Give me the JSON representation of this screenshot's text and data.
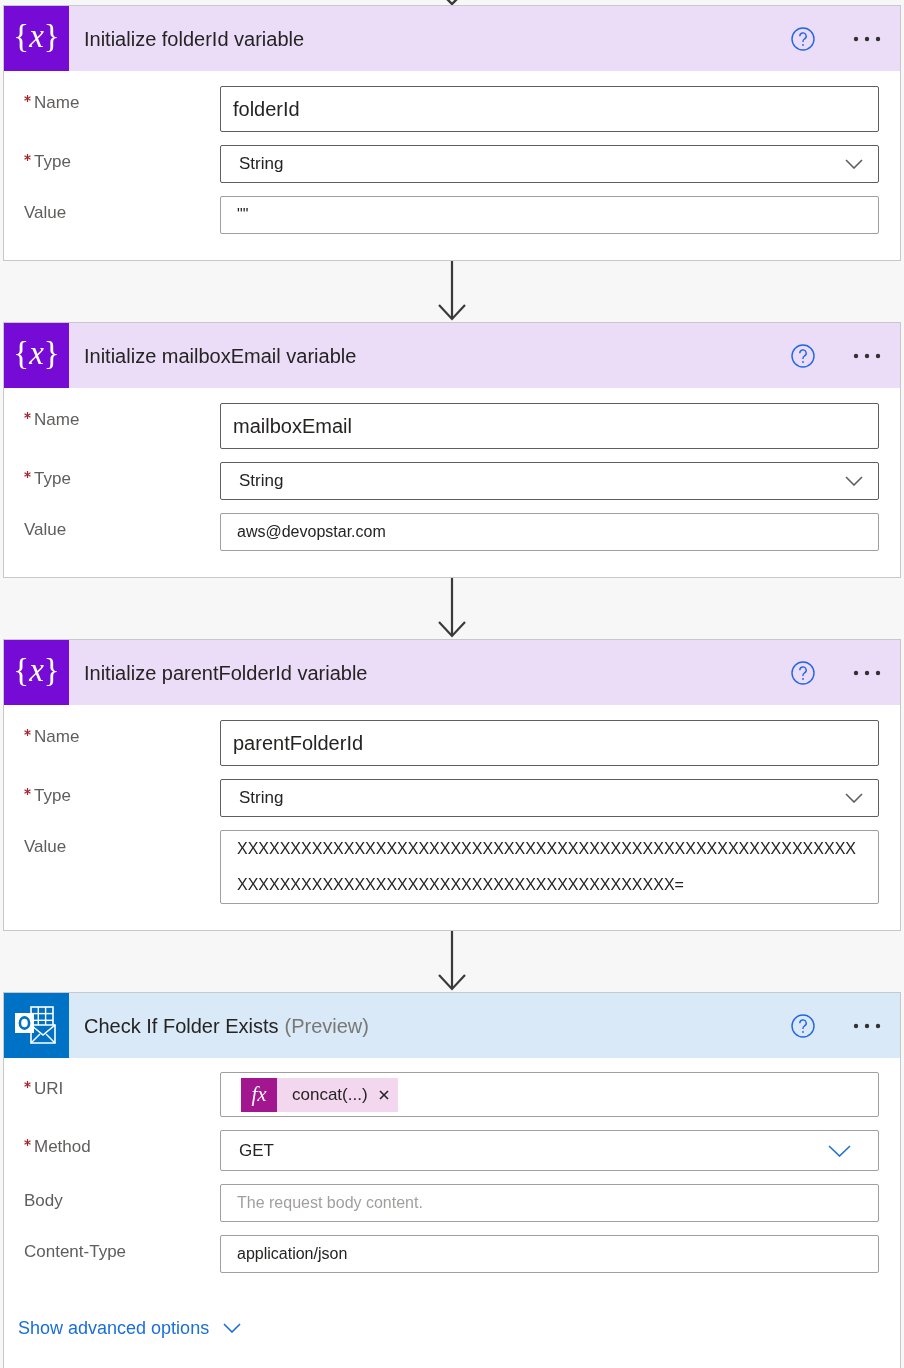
{
  "cards": [
    {
      "kind": "variable",
      "icon_text": "{*x*}",
      "title": "Initialize folderId variable",
      "fields": [
        {
          "kind": "namebox",
          "label": "Name",
          "required": true,
          "value": "folderId"
        },
        {
          "kind": "dropdown",
          "label": "Type",
          "required": true,
          "value": "String"
        },
        {
          "kind": "textbox",
          "label": "Value",
          "required": false,
          "value": "\"\""
        }
      ]
    },
    {
      "kind": "variable",
      "icon_text": "{*x*}",
      "title": "Initialize mailboxEmail variable",
      "fields": [
        {
          "kind": "namebox",
          "label": "Name",
          "required": true,
          "value": "mailboxEmail"
        },
        {
          "kind": "dropdown",
          "label": "Type",
          "required": true,
          "value": "String"
        },
        {
          "kind": "textbox",
          "label": "Value",
          "required": false,
          "value": "aws@devopstar.com"
        }
      ]
    },
    {
      "kind": "variable",
      "icon_text": "{*x*}",
      "title": "Initialize parentFolderId variable",
      "fields": [
        {
          "kind": "namebox",
          "label": "Name",
          "required": true,
          "value": "parentFolderId"
        },
        {
          "kind": "dropdown",
          "label": "Type",
          "required": true,
          "value": "String"
        },
        {
          "kind": "textbox",
          "label": "Value",
          "required": false,
          "value": "XXXXXXXXXXXXXXXXXXXXXXXXXXXXXXXXXXXXXXXXXXXXXXXXXXXXXXXXXXXXXXXXXXXXXXXXXXXXXXXXXXXXXXXXXXXXXXXXXXX="
        }
      ]
    },
    {
      "kind": "http",
      "title": "Check If Folder Exists",
      "title_note": "(Preview)",
      "fields": [
        {
          "kind": "tokenbox",
          "label": "URI",
          "required": true,
          "token": {
            "icon_text": "fx",
            "label": "concat(...)"
          }
        },
        {
          "kind": "dropdown",
          "label": "Method",
          "required": true,
          "value": "GET"
        },
        {
          "kind": "textbox",
          "label": "Body",
          "required": false,
          "placeholder": "The request body content."
        },
        {
          "kind": "textbox",
          "label": "Content-Type",
          "required": false,
          "value": "application/json"
        }
      ],
      "advanced_toggle": "Show advanced options"
    }
  ]
}
